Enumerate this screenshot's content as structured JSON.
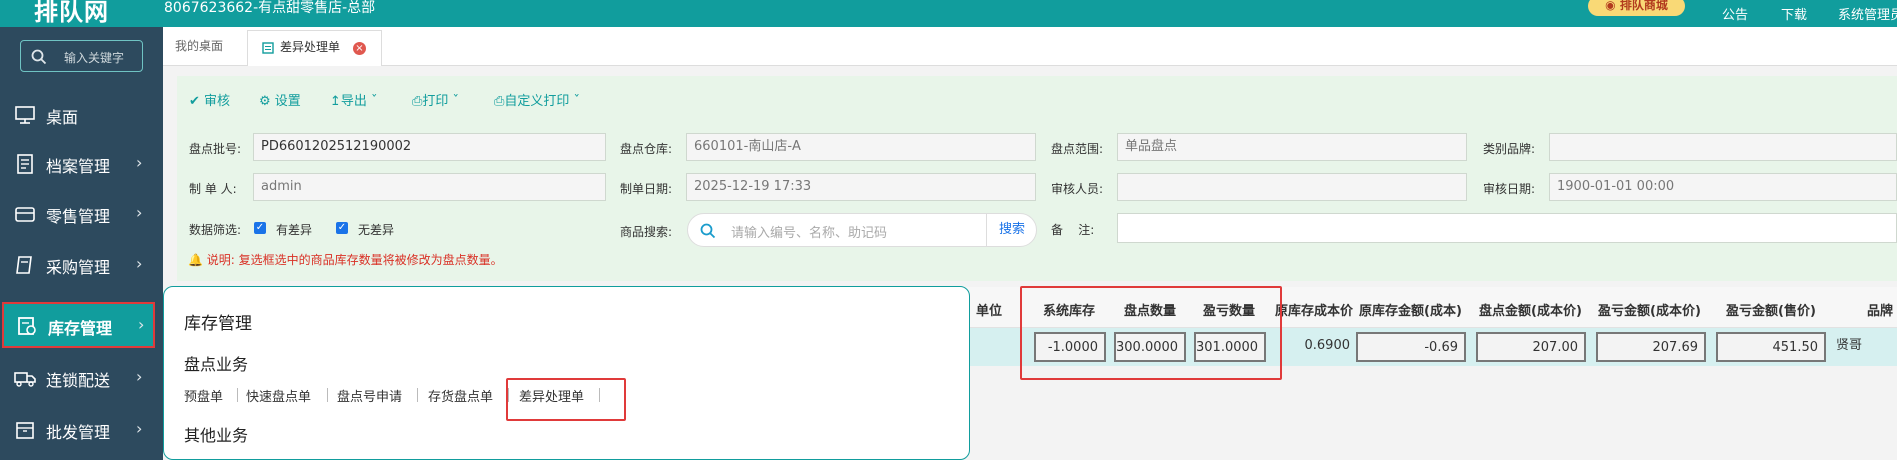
{
  "header": {
    "logo_text": "排队网",
    "store_title": "8067623662-有点甜零售店-总部",
    "mall_button": "排队商城",
    "actions": [
      {
        "label": "公告",
        "icon": "bell-icon"
      },
      {
        "label": "下载",
        "icon": "download-icon"
      },
      {
        "label": "系统管理员",
        "icon": "user-icon"
      }
    ]
  },
  "sidebar": {
    "search_placeholder": "输入关键字",
    "items": [
      {
        "label": "桌面",
        "icon": "monitor-icon"
      },
      {
        "label": "档案管理",
        "icon": "archive-icon"
      },
      {
        "label": "零售管理",
        "icon": "register-icon"
      },
      {
        "label": "采购管理",
        "icon": "clipboard-icon"
      },
      {
        "label": "库存管理",
        "icon": "inventory-icon",
        "active": true
      },
      {
        "label": "连锁配送",
        "icon": "truck-icon"
      },
      {
        "label": "批发管理",
        "icon": "box-icon"
      }
    ]
  },
  "tabs": {
    "home": "我的桌面",
    "current": "差异处理单"
  },
  "toolbar": {
    "audit": "审核",
    "settings": "设置",
    "export": "导出",
    "print": "打印",
    "custom_print": "自定义打印"
  },
  "form": {
    "batch_label": "盘点批号:",
    "batch_value": "PD6601202512190002",
    "warehouse_label": "盘点仓库:",
    "warehouse_value": "660101-南山店-A",
    "range_label": "盘点范围:",
    "range_value": "单品盘点",
    "brand_label": "类别品牌:",
    "brand_value": "",
    "maker_label": "制 单 人:",
    "maker_value": "admin",
    "date_label": "制单日期:",
    "date_value": "2025-12-19 17:33",
    "auditor_label": "审核人员:",
    "auditor_value": "",
    "audit_date_label": "审核日期:",
    "audit_date_value": "1900-01-01 00:00",
    "filter_label": "数据筛选:",
    "has_diff": "有差异",
    "no_diff": "无差异",
    "product_search_label": "商品搜索:",
    "product_search_placeholder": "请输入编号、名称、助记码",
    "search_button": "搜索",
    "remark_label": "备    注:",
    "remark_value": "",
    "notice": "说明: 复选框选中的商品库存数量将被修改为盘点数量。"
  },
  "grid": {
    "headers": [
      "单位",
      "系统库存",
      "盘点数量",
      "盈亏数量",
      "原库存成本价",
      "原库存金额(成本)",
      "盘点金额(成本价)",
      "盈亏金额(成本价)",
      "盈亏金额(售价)",
      "品牌"
    ],
    "row": [
      "",
      "-1.0000",
      "300.0000",
      "301.0000",
      "0.6900",
      "-0.69",
      "207.00",
      "207.69",
      "451.50",
      "贤哥"
    ]
  },
  "popup": {
    "title": "库存管理",
    "section1": "盘点业务",
    "links": [
      "预盘单",
      "快速盘点单",
      "盘点号申请",
      "存货盘点单",
      "差异处理单"
    ],
    "section2": "其他业务"
  }
}
